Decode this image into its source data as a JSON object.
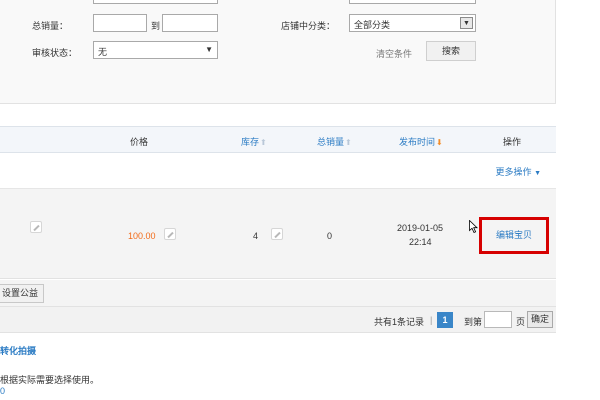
{
  "filters": {
    "total_sales_label": "总销量：",
    "range_separator": "到",
    "shop_category_label": "店铺中分类：",
    "shop_category_value": "全部分类",
    "review_status_label": "审核状态：",
    "review_status_value": "无",
    "clear_label": "清空条件",
    "search_label": "搜索"
  },
  "table": {
    "headers": {
      "price": "价格",
      "stock": "库存",
      "total_sales": "总销量",
      "publish_time": "发布时间",
      "actions": "操作"
    },
    "more_actions": "更多操作",
    "row": {
      "price": "100.00",
      "stock": "4",
      "total_sales": "0",
      "publish_date": "2019-01-05",
      "publish_clock": "22:14",
      "edit_label": "编辑宝贝"
    }
  },
  "action_bar": {
    "charity_label": "设置公益"
  },
  "pager": {
    "summary": "共有1条记录",
    "separator": "|",
    "current_page": "1",
    "goto_label": "到第",
    "page_suffix": "页",
    "confirm_label": "确定"
  },
  "footer": {
    "link_text": "转化拍摄",
    "note_text": "根据实际需要选择使用。",
    "fragment": "0"
  },
  "colors": {
    "link": "#2c7cc4",
    "price": "#f26c1a",
    "highlight_border": "#d60000",
    "sort_active": "#f28c28"
  }
}
